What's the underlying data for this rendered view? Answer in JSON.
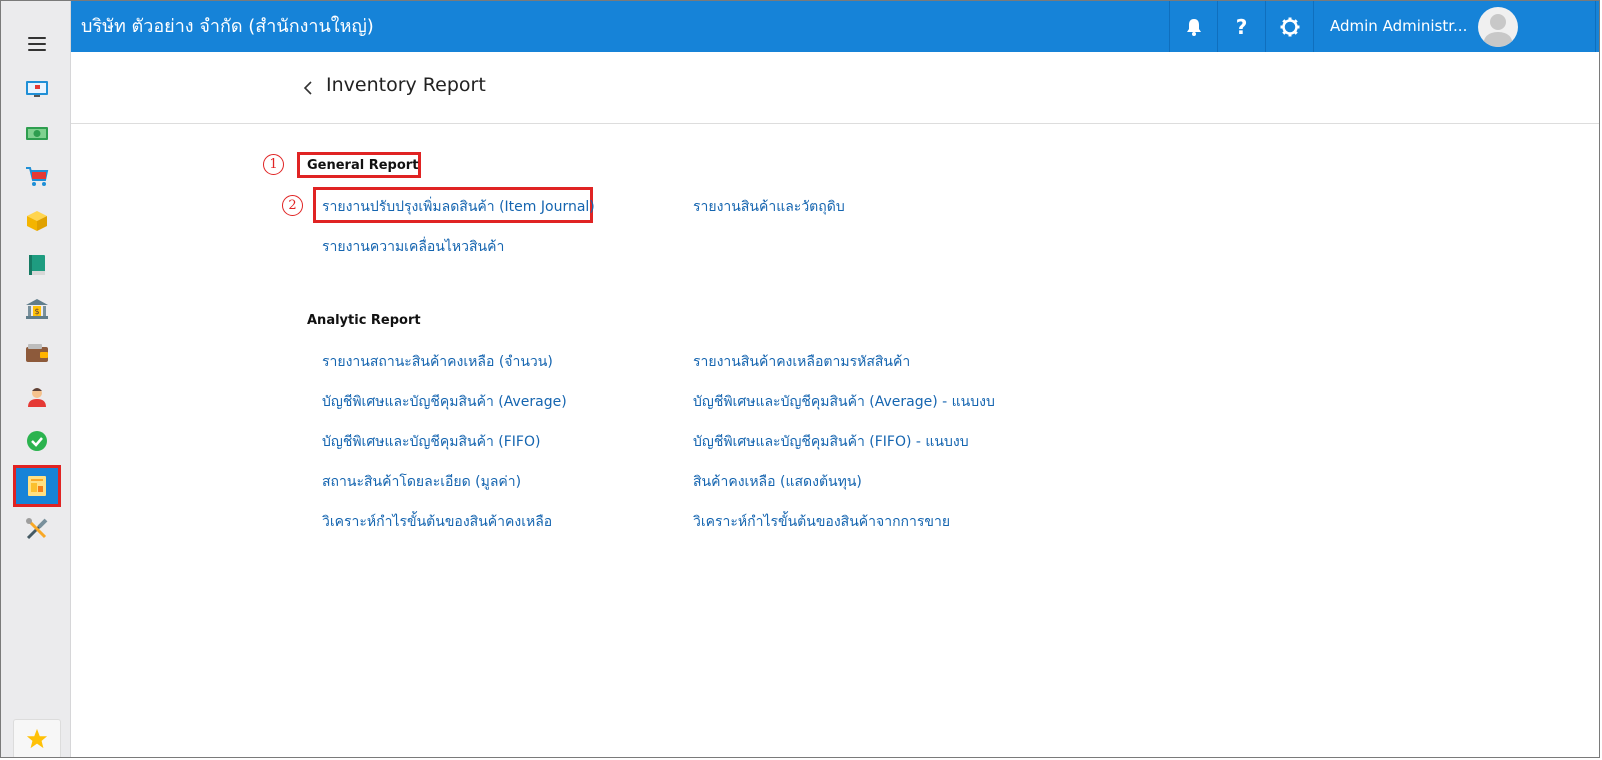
{
  "topbar": {
    "company_name": "บริษัท ตัวอย่าง จำกัด (สำนักงานใหญ่)",
    "user_name": "Admin Administr...",
    "background_color": "#1683d8"
  },
  "page": {
    "title": "Inventory Report"
  },
  "sidebar": {
    "items": [
      {
        "icon": "monitor-icon"
      },
      {
        "icon": "money-icon"
      },
      {
        "icon": "cart-icon"
      },
      {
        "icon": "box-icon"
      },
      {
        "icon": "book-icon"
      },
      {
        "icon": "bank-icon"
      },
      {
        "icon": "wallet-icon"
      },
      {
        "icon": "people-icon"
      },
      {
        "icon": "check-icon"
      },
      {
        "icon": "report-icon",
        "active": true
      },
      {
        "icon": "tools-icon"
      }
    ],
    "favorite_icon": "star-icon"
  },
  "annotations": {
    "marker_1": "1",
    "marker_2": "2",
    "highlight_color": "#e02323"
  },
  "general_report": {
    "title": "General Report",
    "links": [
      "รายงานปรับปรุงเพิ่มลดสินค้า (Item Journal)",
      "รายงานสินค้าและวัตถุดิบ",
      "รายงานความเคลื่อนไหวสินค้า"
    ]
  },
  "analytic_report": {
    "title": "Analytic Report",
    "links": [
      "รายงานสถานะสินค้าคงเหลือ (จำนวน)",
      "รายงานสินค้าคงเหลือตามรหัสสินค้า",
      "บัญชีพิเศษและบัญชีคุมสินค้า (Average)",
      "บัญชีพิเศษและบัญชีคุมสินค้า (Average) - แนบงบ",
      "บัญชีพิเศษและบัญชีคุมสินค้า (FIFO)",
      "บัญชีพิเศษและบัญชีคุมสินค้า (FIFO) - แนบงบ",
      "สถานะสินค้าโดยละเอียด (มูลค่า)",
      "สินค้าคงเหลือ (แสดงต้นทุน)",
      "วิเคราะห์กำไรขั้นต้นของสินค้าคงเหลือ",
      "วิเคราะห์กำไรขั้นต้นของสินค้าจากการขาย"
    ]
  }
}
